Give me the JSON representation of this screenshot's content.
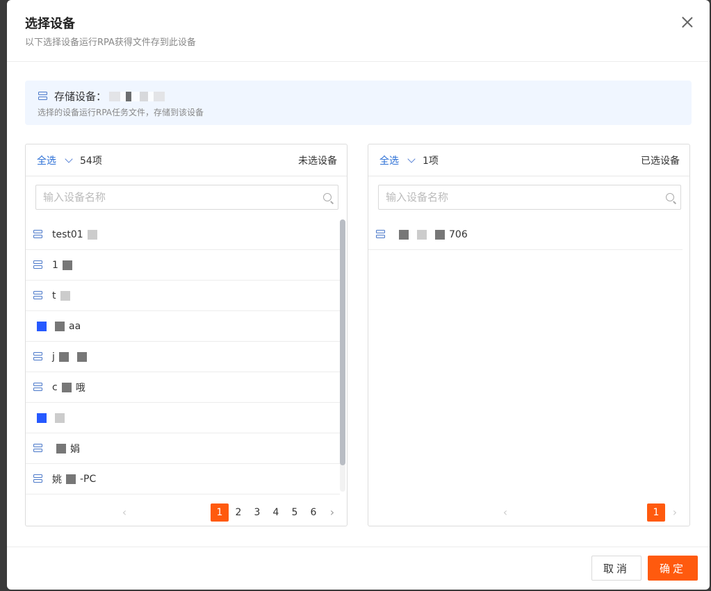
{
  "dialog": {
    "title": "选择设备",
    "subtitle": "以下选择设备运行RPA获得文件存到此设备"
  },
  "storage": {
    "label": "存储设备：",
    "desc": "选择的设备运行RPA任务文件，存储到该设备"
  },
  "left_panel": {
    "select_all": "全选",
    "count": "54项",
    "label": "未选设备",
    "search_placeholder": "输入设备名称",
    "items": [
      {
        "prefix": "test01",
        "suffix": ""
      },
      {
        "prefix": "1",
        "suffix": ""
      },
      {
        "prefix": "t",
        "suffix": ""
      },
      {
        "prefix": "",
        "suffix": "aa"
      },
      {
        "prefix": "j",
        "suffix": ""
      },
      {
        "prefix": "c",
        "suffix": "哦"
      },
      {
        "prefix": "",
        "suffix": ""
      },
      {
        "prefix": "",
        "suffix": "娟"
      },
      {
        "prefix": "姚",
        "suffix": "-PC"
      }
    ],
    "pages": [
      "1",
      "2",
      "3",
      "4",
      "5",
      "6"
    ],
    "current_page": "1"
  },
  "right_panel": {
    "select_all": "全选",
    "count": "1项",
    "label": "已选设备",
    "search_placeholder": "输入设备名称",
    "items": [
      {
        "prefix": "",
        "suffix": "706"
      }
    ],
    "pages": [
      "1"
    ],
    "current_page": "1"
  },
  "footer": {
    "cancel_label": "取消",
    "ok_label": "确定"
  },
  "colors": {
    "accent": "#ff5a0e",
    "link": "#2b6fd6",
    "info_bg": "#f0f6ff"
  }
}
